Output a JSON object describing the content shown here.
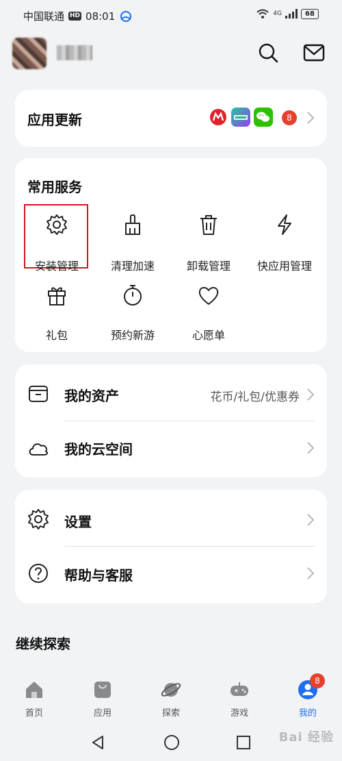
{
  "status_bar": {
    "carrier": "中国联通",
    "hd": "HD",
    "time": "08:01",
    "network": "4G",
    "battery": "68"
  },
  "header": {
    "search_icon": "search-icon",
    "mail_icon": "mail-icon"
  },
  "app_update": {
    "title": "应用更新",
    "badge": "8"
  },
  "services": {
    "title": "常用服务",
    "items": [
      {
        "label": "安装管理",
        "icon": "gear-icon"
      },
      {
        "label": "清理加速",
        "icon": "broom-icon"
      },
      {
        "label": "卸载管理",
        "icon": "trash-icon"
      },
      {
        "label": "快应用管理",
        "icon": "bolt-icon"
      },
      {
        "label": "礼包",
        "icon": "gift-icon"
      },
      {
        "label": "预约新游",
        "icon": "stopwatch-icon"
      },
      {
        "label": "心愿单",
        "icon": "heart-icon"
      }
    ]
  },
  "assets": {
    "my_assets": "我的资产",
    "my_assets_extra": "花币/礼包/优惠券",
    "my_cloud": "我的云空间"
  },
  "settings_card": {
    "settings": "设置",
    "help": "帮助与客服"
  },
  "explore": {
    "title": "继续探索"
  },
  "bottom_nav": {
    "items": [
      {
        "label": "首页",
        "icon": "home-icon"
      },
      {
        "label": "应用",
        "icon": "bag-icon"
      },
      {
        "label": "探索",
        "icon": "planet-icon"
      },
      {
        "label": "游戏",
        "icon": "gamepad-icon"
      },
      {
        "label": "我的",
        "icon": "profile-icon"
      }
    ],
    "profile_badge": "8"
  },
  "watermark": "Bai 经验",
  "colors": {
    "accent": "#1e6ff0",
    "badge": "#e5412d",
    "highlight": "#d0151d"
  }
}
